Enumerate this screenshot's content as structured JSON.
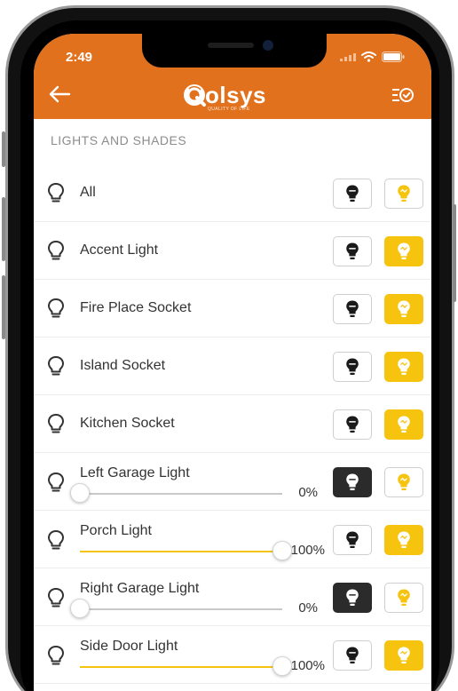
{
  "status_bar": {
    "time": "2:49"
  },
  "header": {
    "logo_text": "olsys",
    "logo_tagline": "QUALITY OF LIFE"
  },
  "section_title": "LIGHTS AND SHADES",
  "colors": {
    "header_orange": "#e2711d",
    "bulb_yellow": "#f6c30f",
    "off_dark": "#2b2b2b"
  },
  "icons": {
    "back": "arrow-left-icon",
    "scene": "list-check-icon",
    "row": "lightbulb-outline-icon",
    "off": "bulb-off-icon",
    "on": "bulb-on-icon"
  },
  "lights": [
    {
      "name": "All",
      "has_dimmer": false,
      "state": "none"
    },
    {
      "name": "Accent Light",
      "has_dimmer": false,
      "state": "on"
    },
    {
      "name": "Fire Place Socket",
      "has_dimmer": false,
      "state": "on"
    },
    {
      "name": "Island Socket",
      "has_dimmer": false,
      "state": "on"
    },
    {
      "name": "Kitchen Socket",
      "has_dimmer": false,
      "state": "on"
    },
    {
      "name": "Left Garage Light",
      "has_dimmer": true,
      "level": 0,
      "level_text": "0%",
      "state": "off"
    },
    {
      "name": "Porch Light",
      "has_dimmer": true,
      "level": 100,
      "level_text": "100%",
      "state": "on"
    },
    {
      "name": "Right Garage Light",
      "has_dimmer": true,
      "level": 0,
      "level_text": "0%",
      "state": "off"
    },
    {
      "name": "Side Door Light",
      "has_dimmer": true,
      "level": 100,
      "level_text": "100%",
      "state": "on"
    }
  ]
}
